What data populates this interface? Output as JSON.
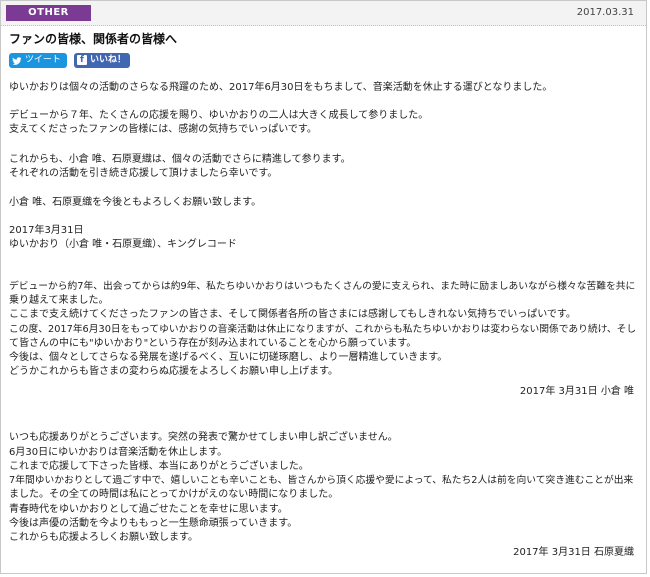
{
  "header": {
    "category": "OTHER",
    "date": "2017.03.31"
  },
  "post": {
    "title": "ファンの皆様、関係者の皆様へ"
  },
  "share": {
    "tweet_label": "ツイート",
    "like_label": "いいね！"
  },
  "body": {
    "p1": "ゆいかおりは個々の活動のさらなる飛躍のため、2017年6月30日をもちまして、音楽活動を休止する運びとなりました。",
    "p2_l1": "デビューから７年、たくさんの応援を賜り、ゆいかおりの二人は大きく成長して参りました。",
    "p2_l2": "支えてくださったファンの皆様には、感謝の気持ちでいっぱいです。",
    "p3_l1": "これからも、小倉 唯、石原夏織は、個々の活動でさらに精進して参ります。",
    "p3_l2": "それぞれの活動を引き続き応援して頂けましたら幸いです。",
    "p4": "小倉 唯、石原夏織を今後ともよろしくお願い致します。",
    "sign_date": "2017年3月31日",
    "sign_names": "ゆいかおり（小倉 唯・石原夏織）、キングレコード"
  },
  "ogura_message": {
    "l1": "デビューから約7年、出会ってからは約9年、私たちゆいかおりはいつもたくさんの愛に支えられ、また時に励ましあいながら様々な苦難を共に",
    "l2": "乗り越えて来ました。",
    "l3": "ここまで支え続けてくださったファンの皆さま、そして関係者各所の皆さまには感謝してもしきれない気持ちでいっぱいです。",
    "l4": "この度、2017年6月30日をもってゆいかおりの音楽活動は休止になりますが、これからも私たちゆいかおりは変わらない関係であり続け、そし",
    "l5": "て皆さんの中にも\"ゆいかおり\"という存在が刻み込まれていることを心から願っています。",
    "l6": "今後は、個々としてさらなる発展を遂げるべく、互いに切磋琢磨し、より一層精進していきます。",
    "l7": "どうかこれからも皆さまの変わらぬ応援をよろしくお願い申し上げます。",
    "signature": "2017年 3月31日 小倉 唯"
  },
  "ishihara_message": {
    "l1": "いつも応援ありがとうございます。突然の発表で驚かせてしまい申し訳ございません。",
    "l2": "6月30日にゆいかおりは音楽活動を休止します。",
    "l3": "これまで応援して下さった皆様、本当にありがとうございました。",
    "l4": "7年間ゆいかおりとして過ごす中で、嬉しいことも辛いことも、皆さんから頂く応援や愛によって、私たち2人は前を向いて突き進むことが出来",
    "l5": "ました。その全ての時間は私にとってかけがえのない時間になりました。",
    "l6": "青春時代をゆいかおりとして過ごせたことを幸せに思います。",
    "l7": "今後は声優の活動を今よりももっと一生懸命頑張っていきます。",
    "l8": "これからも応援よろしくお願い致します。",
    "signature": "2017年 3月31日 石原夏織"
  },
  "colors": {
    "badge": "#7b3b94",
    "tweet": "#1b95e0",
    "like": "#4267b2"
  }
}
